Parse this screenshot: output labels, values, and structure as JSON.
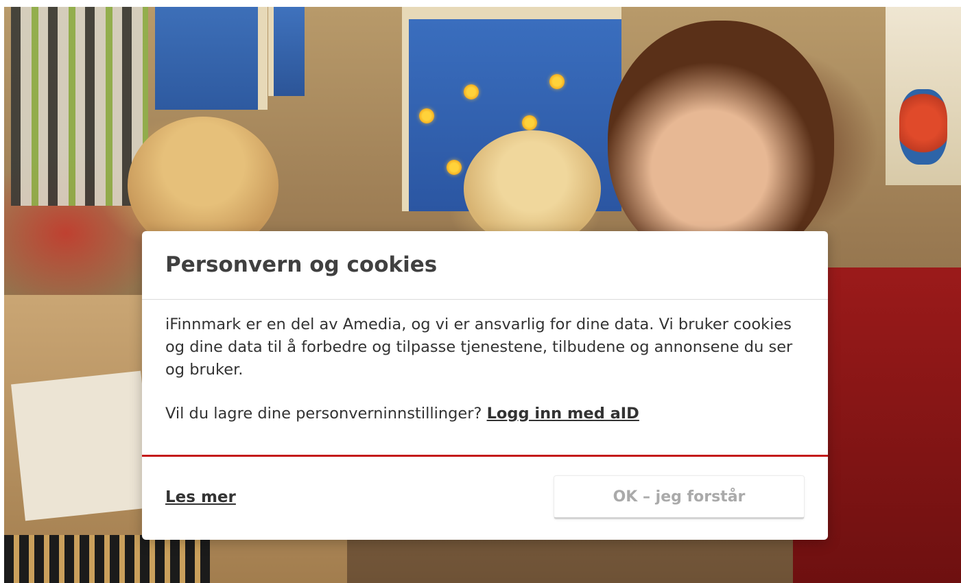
{
  "dialog": {
    "title": "Personvern og cookies",
    "body_paragraph": "iFinnmark er en del av Amedia, og vi er ansvarlig for dine data. Vi bruker cookies og dine data til å forbedre og tilpasse tjenestene, tilbudene og annonsene du ser og bruker.",
    "save_settings_prompt": "Vil du lagre dine personverninnstillinger?",
    "login_link_label": "Logg inn med aID",
    "read_more_label": "Les mer",
    "ok_button_label": "OK – jeg forstår",
    "colors": {
      "divider_accent": "#c41a1a",
      "title_text": "#404040",
      "body_text": "#333333",
      "button_text_disabled": "#aaaaaa"
    }
  }
}
